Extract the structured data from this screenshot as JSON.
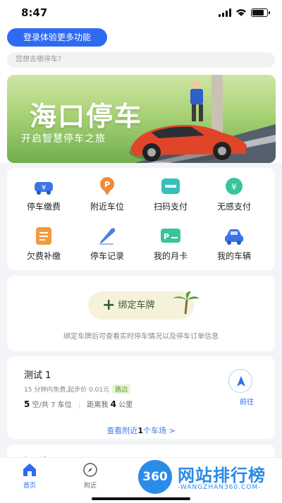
{
  "status": {
    "time": "8:47"
  },
  "header": {
    "login_label": "登录体验更多功能",
    "search_placeholder": "您想去哪停车?"
  },
  "banner": {
    "title": "海口停车",
    "subtitle": "开启智慧停车之旅"
  },
  "services": [
    {
      "label": "停车缴费",
      "icon": "car-yuan-icon",
      "color": "#3c74e8"
    },
    {
      "label": "附近车位",
      "icon": "parking-pin-icon",
      "color": "#f08a3c"
    },
    {
      "label": "扫码支付",
      "icon": "card-scan-icon",
      "color": "#35c0b9"
    },
    {
      "label": "无感支付",
      "icon": "yuan-coin-icon",
      "color": "#39c49a"
    },
    {
      "label": "欠费补缴",
      "icon": "bill-icon",
      "color": "#f39a3e"
    },
    {
      "label": "停车记录",
      "icon": "pen-icon",
      "color": "#4f7fe6"
    },
    {
      "label": "我的月卡",
      "icon": "p-card-icon",
      "color": "#39c49a"
    },
    {
      "label": "我的车辆",
      "icon": "car-icon",
      "color": "#3c74e8"
    }
  ],
  "bind_plate": {
    "label": "绑定车牌",
    "tip": "绑定车牌后可查看实时停车情况以及停车订单信息"
  },
  "parking_lot": {
    "name": "测试 1",
    "price": "15 分钟内免费,起步价 0.01元",
    "badge": "路边",
    "empty": "5",
    "empty_label": "空/共",
    "total": "7",
    "total_label": "车位",
    "distance_label": "距离我",
    "distance": "4",
    "distance_unit": "公里",
    "go_label": "前往",
    "more_pre": "查看附近",
    "more_count": "1",
    "more_post": "个车场 >"
  },
  "next_card": {
    "title": "海口湾..."
  },
  "tabs": [
    {
      "label": "首页",
      "active": true
    },
    {
      "label": "附近",
      "active": false
    }
  ],
  "watermark": {
    "circle": "360",
    "brand": "网站排行榜",
    "url": "-WANGZHAN360.COM-"
  },
  "colors": {
    "primary": "#2f6bf2",
    "badge_bg": "#e8f4d8",
    "badge_fg": "#5c9b2c"
  }
}
